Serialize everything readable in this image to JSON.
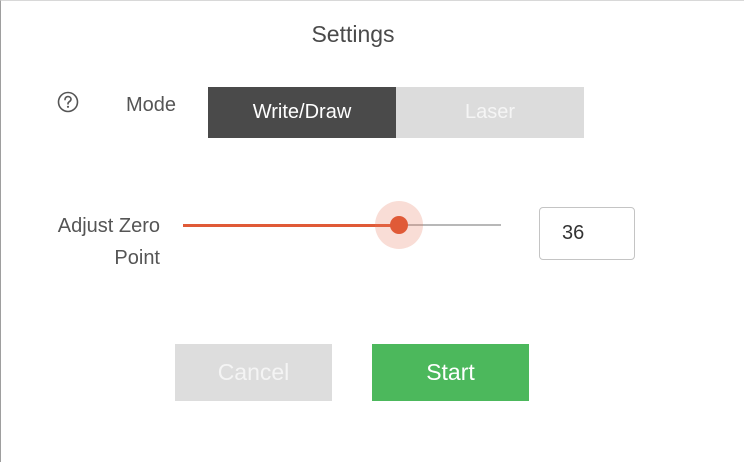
{
  "dialog": {
    "title": "Settings"
  },
  "mode": {
    "help_icon": "question-circle-icon",
    "label": "Mode",
    "options": [
      {
        "label": "Write/Draw",
        "selected": true
      },
      {
        "label": "Laser",
        "selected": false
      }
    ]
  },
  "zero_point": {
    "label_line1": "Adjust Zero",
    "label_line2": "Point",
    "slider_fraction": 0.68,
    "value": "36"
  },
  "buttons": {
    "cancel_label": "Cancel",
    "start_label": "Start"
  },
  "colors": {
    "segment_active": "#4a4a4a",
    "segment_inactive": "#dcdcdc",
    "slider_accent": "#e05a37",
    "start_button": "#4cb85c",
    "cancel_button": "#dddddd"
  }
}
